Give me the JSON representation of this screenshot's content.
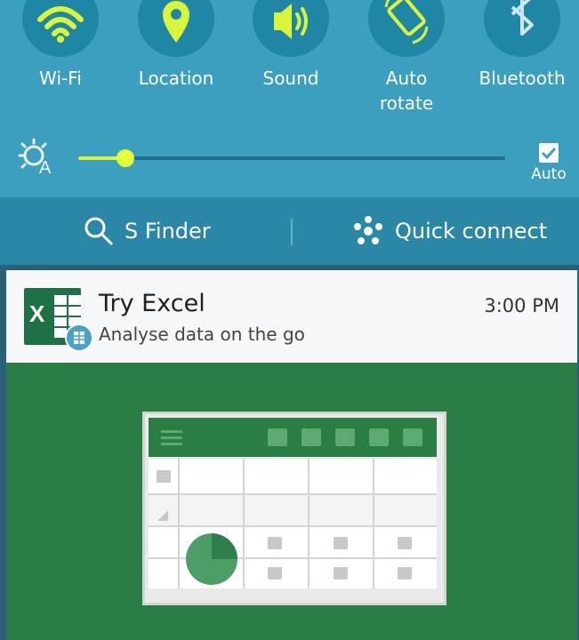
{
  "quick_settings": {
    "toggles": [
      {
        "label": "Wi-Fi",
        "icon": "wifi-icon"
      },
      {
        "label": "Location",
        "icon": "location-pin-icon"
      },
      {
        "label": "Sound",
        "icon": "speaker-icon"
      },
      {
        "label": "Auto\nrotate",
        "icon": "auto-rotate-icon"
      },
      {
        "label": "Bluetooth",
        "icon": "bluetooth-icon"
      }
    ],
    "brightness": {
      "level": 0.11,
      "auto_label": "Auto",
      "auto_checked": true
    },
    "colors": {
      "panel": "#3c9fbf",
      "toggle_bg": "#2086a5",
      "active_icon": "#d9f53a"
    }
  },
  "finder_bar": {
    "s_finder_label": "S Finder",
    "quick_connect_label": "Quick connect"
  },
  "notification": {
    "title": "Try Excel",
    "subtitle": "Analyse data on the go",
    "time": "3:00 PM",
    "app_icon_letter": "X",
    "accent": "#2a7d45"
  }
}
